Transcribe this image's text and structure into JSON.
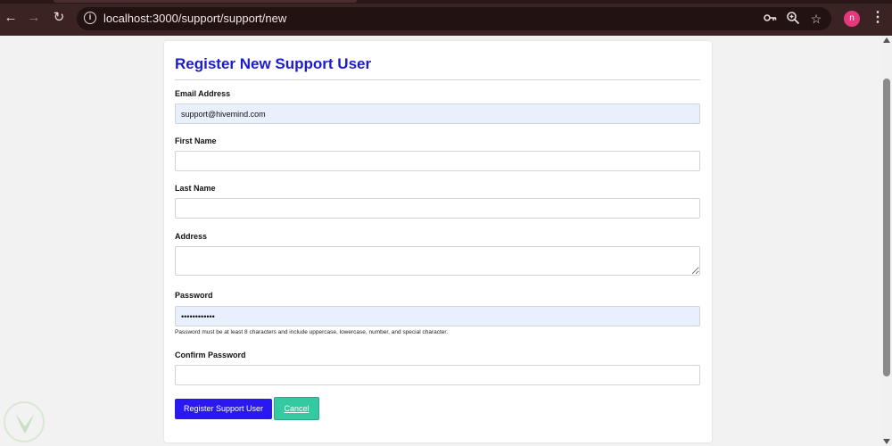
{
  "browser": {
    "url": "localhost:3000/support/support/new",
    "icons": {
      "back": "back-arrow-icon",
      "forward": "forward-arrow-icon",
      "reload": "reload-icon",
      "site_info": "site-info-icon",
      "password_key": "key-icon",
      "zoom": "zoom-icon",
      "bookmark": "star-icon",
      "menu": "more-vert-icon"
    },
    "avatar_initial": "n",
    "avatar_color": "#e6397b",
    "chrome_color": "#3c2323"
  },
  "form": {
    "title": "Register New Support User",
    "title_color": "#1a1ad6",
    "fields": {
      "email": {
        "label": "Email Address",
        "value": "support@hivemind.com"
      },
      "first_name": {
        "label": "First Name",
        "value": ""
      },
      "last_name": {
        "label": "Last Name",
        "value": ""
      },
      "address": {
        "label": "Address",
        "value": ""
      },
      "password": {
        "label": "Password",
        "value": "••••••••••••",
        "helper": "Password must be at least 8 characters and include uppercase, lowercase, number, and special character."
      },
      "confirm_password": {
        "label": "Confirm Password",
        "value": ""
      }
    },
    "buttons": {
      "submit": {
        "label": "Register Support User",
        "color": "#2a18f0"
      },
      "cancel": {
        "label": "Cancel",
        "color": "#33c9a1"
      }
    }
  }
}
